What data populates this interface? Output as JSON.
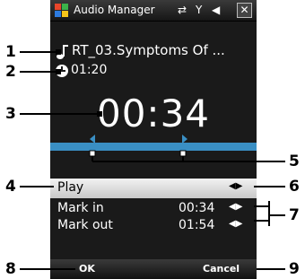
{
  "window": {
    "title": "Audio Manager",
    "close_label": "✕"
  },
  "status_icons": {
    "connectivity": "⇄",
    "signal": "Y",
    "volume": "◀€"
  },
  "track": {
    "name": "RT_03.Symptoms Of ...",
    "duration": "01:20",
    "music_icon": "music-note-icon",
    "clock_icon": "clock-icon"
  },
  "player": {
    "current_time": "00:34",
    "progress_color": "#3a8fc4"
  },
  "menu": {
    "play_label": "Play",
    "mark_in_label": "Mark in",
    "mark_in_value": "00:34",
    "mark_out_label": "Mark out",
    "mark_out_value": "01:54",
    "arrows": "◀▶"
  },
  "softkeys": {
    "left": "OK",
    "right": "Cancel"
  },
  "callouts": [
    "1",
    "2",
    "3",
    "4",
    "5",
    "6",
    "7",
    "8",
    "9"
  ]
}
